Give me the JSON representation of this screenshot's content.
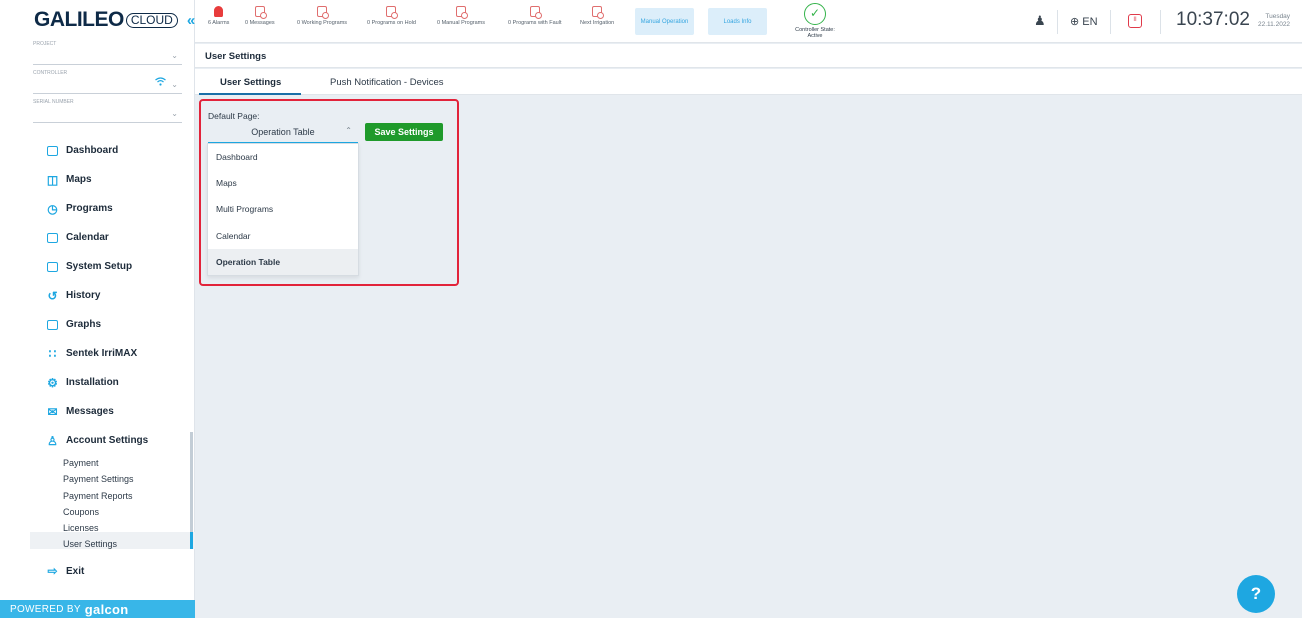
{
  "brand": {
    "logo_main": "GALILEO",
    "logo_cloud": "CLOUD",
    "collapse_glyph": "«",
    "powered_prefix": "POWERED BY",
    "powered_brand": "galcon"
  },
  "selectors": [
    {
      "label": "PROJECT",
      "value": ""
    },
    {
      "label": "CONTROLLER",
      "value": ""
    },
    {
      "label": "SERIAL NUMBER",
      "value": ""
    }
  ],
  "nav": [
    {
      "label": "Dashboard",
      "icon": "dashboard-icon"
    },
    {
      "label": "Maps",
      "icon": "map-icon"
    },
    {
      "label": "Programs",
      "icon": "clock-icon"
    },
    {
      "label": "Calendar",
      "icon": "calendar-icon"
    },
    {
      "label": "System Setup",
      "icon": "system-setup-icon"
    },
    {
      "label": "History",
      "icon": "history-icon"
    },
    {
      "label": "Graphs",
      "icon": "graphs-icon"
    },
    {
      "label": "Sentek IrriMAX",
      "icon": "sentek-icon"
    },
    {
      "label": "Installation",
      "icon": "installation-icon"
    },
    {
      "label": "Messages",
      "icon": "messages-icon"
    },
    {
      "label": "Account Settings",
      "icon": "account-settings-icon"
    }
  ],
  "account_sub": [
    "Payment",
    "Payment Settings",
    "Payment Reports",
    "Coupons",
    "Licenses",
    "User Settings"
  ],
  "exit_label": "Exit",
  "topbar": {
    "stats": [
      {
        "label": "6 Alarms"
      },
      {
        "label": "0 Messages"
      },
      {
        "label": "0 Working Programs"
      },
      {
        "label": "0 Programs on Hold"
      },
      {
        "label": "0 Manual Programs"
      },
      {
        "label": "0 Programs with Fault"
      },
      {
        "label": "Next Irrigation"
      }
    ],
    "manual_operation": "Manual Operation",
    "loads_info": "Loads Info",
    "controller_state_label": "Controller State:",
    "controller_state_value": "Active",
    "language": "EN",
    "time": "10:37:02",
    "day": "Tuesday",
    "date": "22.11.2022"
  },
  "page": {
    "title": "User Settings",
    "tabs": [
      "User Settings",
      "Push Notification - Devices"
    ],
    "default_page_label": "Default Page:",
    "default_page_value": "Operation Table",
    "save_button": "Save Settings",
    "options": [
      "Dashboard",
      "Maps",
      "Multi Programs",
      "Calendar",
      "Operation Table"
    ],
    "selected_option": "Operation Table"
  },
  "help_label": "?",
  "colors": {
    "accent": "#1ea7e1",
    "save_green": "#1f9a2b",
    "highlight_red": "#e2233a",
    "alarm_red": "#e83c3c"
  }
}
